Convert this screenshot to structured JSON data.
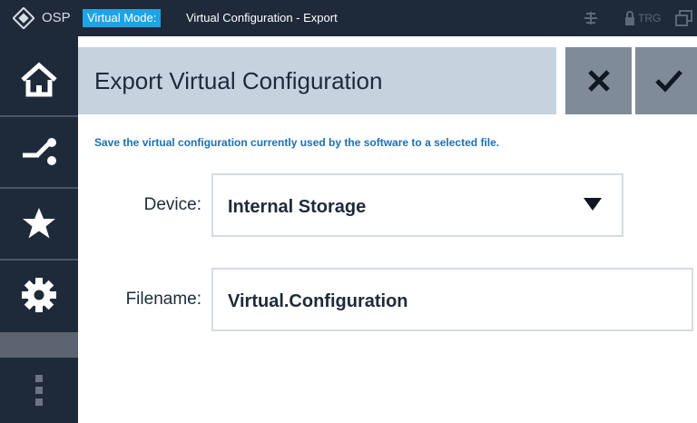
{
  "topbar": {
    "app_label": "OSP",
    "mode_label": "Virtual Mode:",
    "title": "Virtual Configuration - Export",
    "trg_label": "TRG"
  },
  "sidebar": {
    "items": [
      {
        "icon": "home-icon"
      },
      {
        "icon": "connection-icon"
      },
      {
        "icon": "star-icon"
      },
      {
        "icon": "gear-icon"
      },
      {
        "icon": "more-icon"
      }
    ]
  },
  "dialog": {
    "title": "Export Virtual Configuration",
    "cancel_icon": "close-icon",
    "confirm_icon": "check-icon",
    "description": "Save the virtual configuration currently used by the software to a selected file.",
    "device_label": "Device:",
    "device_value": "Internal Storage",
    "filename_label": "Filename:",
    "filename_value": "Virtual.Configuration"
  },
  "colors": {
    "nav_bg": "#1e2a3a",
    "badge": "#1fa3e4",
    "header_bg": "#c6d2de",
    "button_bg": "#7f8b98",
    "description_text": "#1e6fb3"
  }
}
